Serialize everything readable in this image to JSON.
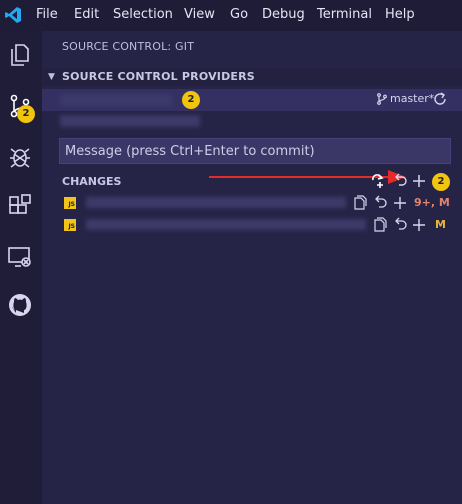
{
  "menu": [
    "File",
    "Edit",
    "Selection",
    "View",
    "Go",
    "Debug",
    "Terminal",
    "Help"
  ],
  "activity_badge": "2",
  "sidebar": {
    "title": "SOURCE CONTROL: GIT",
    "providers_header": "SOURCE CONTROL PROVIDERS",
    "provider": {
      "badge": "2",
      "branch": "master*"
    },
    "commit_placeholder": "Message (press Ctrl+Enter to commit)",
    "changes": {
      "label": "CHANGES",
      "count": "2",
      "files": [
        {
          "icon": "JS",
          "status": "9+, M",
          "status_color": "#e0846e"
        },
        {
          "icon": "JS",
          "status": "M",
          "status_color": "#e8b53a"
        }
      ]
    }
  },
  "colors": {
    "accent_badge": "#f1c40f",
    "annotation_arrow": "#e52a2a"
  }
}
